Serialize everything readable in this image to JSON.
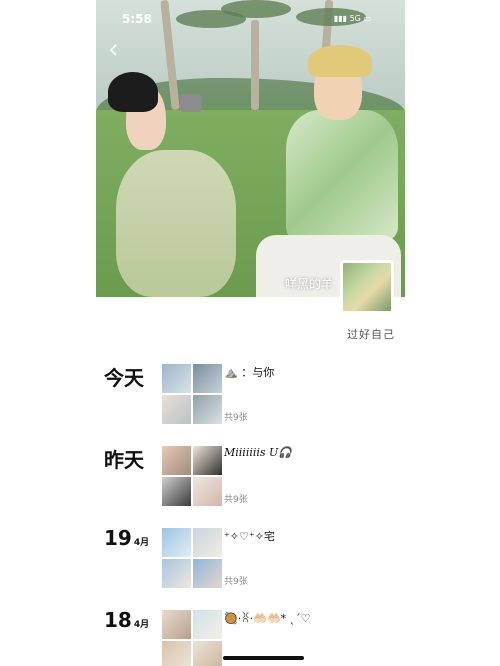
{
  "status": {
    "time": "5:58",
    "network": "5G"
  },
  "profile": {
    "nickname": "咩黑的羊",
    "signature": "过好自己"
  },
  "days": [
    {
      "label": "今天",
      "num": "",
      "month": "",
      "text": "⛰️ ：与你",
      "count": "共9张"
    },
    {
      "label": "昨天",
      "num": "",
      "month": "",
      "text": "Miiiiiiis U🎧",
      "count": "共9张"
    },
    {
      "label": "",
      "num": "19",
      "month": "4月",
      "text": "⁺✧♡⁺✧宅",
      "count": "共9张"
    },
    {
      "label": "",
      "num": "18",
      "month": "4月",
      "text": "🥘·ꐦ·🤲🏻🤲🏻* ˎˊ♡",
      "count": ""
    }
  ],
  "colors": {
    "background": "#ffffff",
    "text": "#111111",
    "muted": "#8a8a8a",
    "grass": "#7aa35a"
  }
}
